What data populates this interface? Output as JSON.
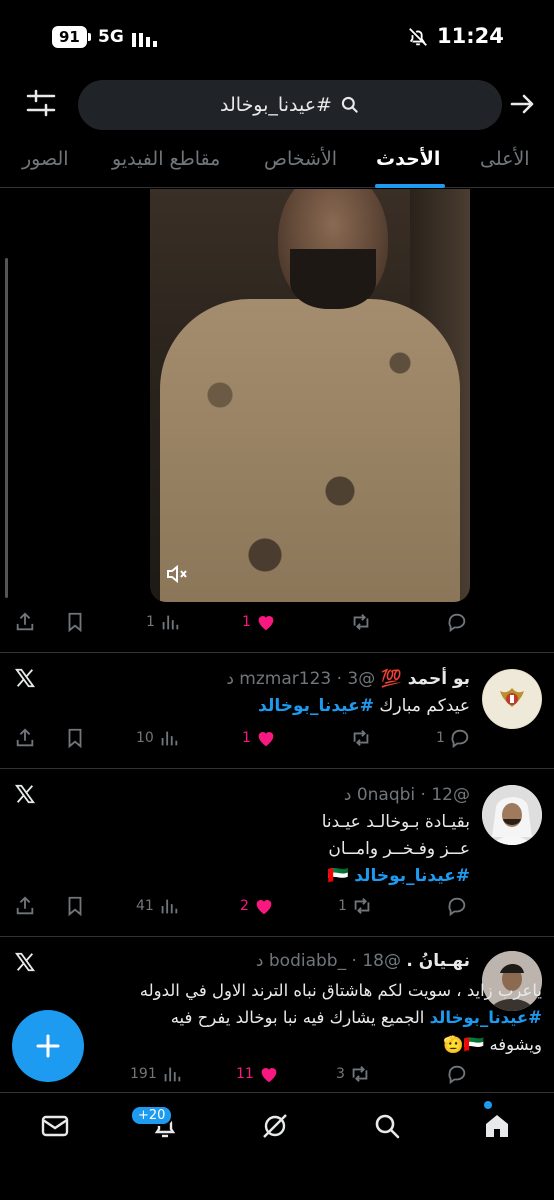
{
  "status": {
    "battery": "91",
    "network": "5G",
    "time": "11:24"
  },
  "search": {
    "query": "#عيدنا_بوخالد"
  },
  "tabs": [
    {
      "label": "الأعلى"
    },
    {
      "label": "الأحدث"
    },
    {
      "label": "الأشخاص"
    },
    {
      "label": "مقاطع الفيديو"
    },
    {
      "label": "الصور"
    }
  ],
  "video_tweet": {
    "views": "1",
    "likes": "1"
  },
  "tweets": [
    {
      "name": "بو أحمد 💯",
      "handle": "@mzmar123",
      "time": "3 د",
      "lines": [
        "عيدكم مبارك"
      ],
      "hashtag": "#عيدنا_بوخالد",
      "replies": "1",
      "retweets": "",
      "likes": "1",
      "views": "10"
    },
    {
      "name": "",
      "handle": "@0naqbi",
      "time": "12 د",
      "lines": [
        "بقيـادة بـوخالـد عيـدنا",
        "عــز وفـخــر وامــان"
      ],
      "hashtag": "#عيدنا_بوخالد",
      "replies": "",
      "retweets": "1",
      "likes": "2",
      "views": "41"
    },
    {
      "name": "نهـيانُ .",
      "handle": "@bodiabb_",
      "time": "18 د",
      "line1": "ياعرب زايد ، سويت لكم هاشتاق نباه الترند الاول في الدوله",
      "line2_tag": "#عيدنا_بوخالد",
      "line2_rest": "الجميع يشارك فيه نبا بوخالد يفرح فيه",
      "line3": "ويشوفه 🇦🇪🫡",
      "replies": "",
      "retweets": "3",
      "likes": "11",
      "views": "191"
    }
  ],
  "nav": {
    "notifications_badge": "+20"
  },
  "icons": [
    "filter-icon",
    "search-icon",
    "arrow-right-icon",
    "x-logo-icon",
    "reply-icon",
    "retweet-icon",
    "heart-icon",
    "views-icon",
    "bookmark-icon",
    "share-icon",
    "plus-icon",
    "mail-icon",
    "bell-icon",
    "grok-icon",
    "home-icon"
  ],
  "colors": {
    "accent": "#1d9bf0",
    "like": "#f91880",
    "muted": "#71767b",
    "text": "#e7e9ea",
    "background": "#000000"
  }
}
